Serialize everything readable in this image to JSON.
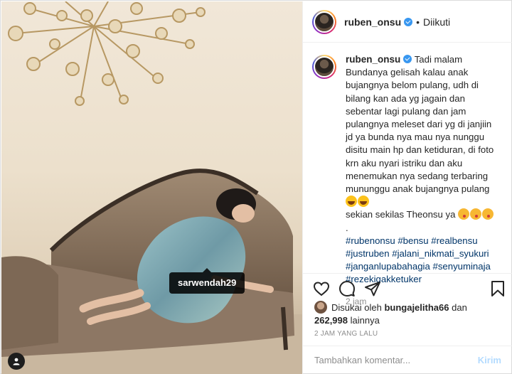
{
  "post": {
    "username": "ruben_onsu",
    "follow_state": "Diikuti",
    "separator": "•",
    "caption_lines": [
      "Tadi malam Bundanya gelisah kalau anak bujangnya belom pulang, udh di bilang kan ada yg jagain dan sebentar lagi pulang dan jam pulangnya meleset dari yg di janjiin jd ya bunda nya mau nya nunggu disitu main hp dan ketiduran, di foto krn aku nyari istriku dan aku menemukan nya sedang terbaring mununggu anak bujangnya pulang"
    ],
    "caption_line2": "sekian sekilas Theonsu ya",
    "caption_dot": ".",
    "hashtags": [
      "#rubenonsu",
      "#bensu",
      "#realbensu",
      "#justruben",
      "#jalani_nikmati_syukuri",
      "#janganlupabahagia",
      "#senyuminaja",
      "#rezekigakketuker"
    ],
    "time_ago": "2 jam",
    "tag_label": "sarwendah29",
    "likes": {
      "prefix": "Disukai oleh",
      "first_liker": "bungajelitha66",
      "and": "dan",
      "count": "262,998",
      "suffix": "lainnya"
    },
    "date": "2 JAM YANG LALU",
    "comment": {
      "placeholder": "Tambahkan komentar...",
      "post_label": "Kirim"
    }
  },
  "icons": {
    "like": "heart-icon",
    "comment": "comment-icon",
    "share": "send-icon",
    "save": "bookmark-icon",
    "verified": "verified-badge-icon",
    "tags": "user-tag-icon"
  },
  "colors": {
    "hashtag": "#003569",
    "verified": "#3897f0",
    "muted": "#8e8e8e",
    "post_button": "#b3dbff"
  }
}
